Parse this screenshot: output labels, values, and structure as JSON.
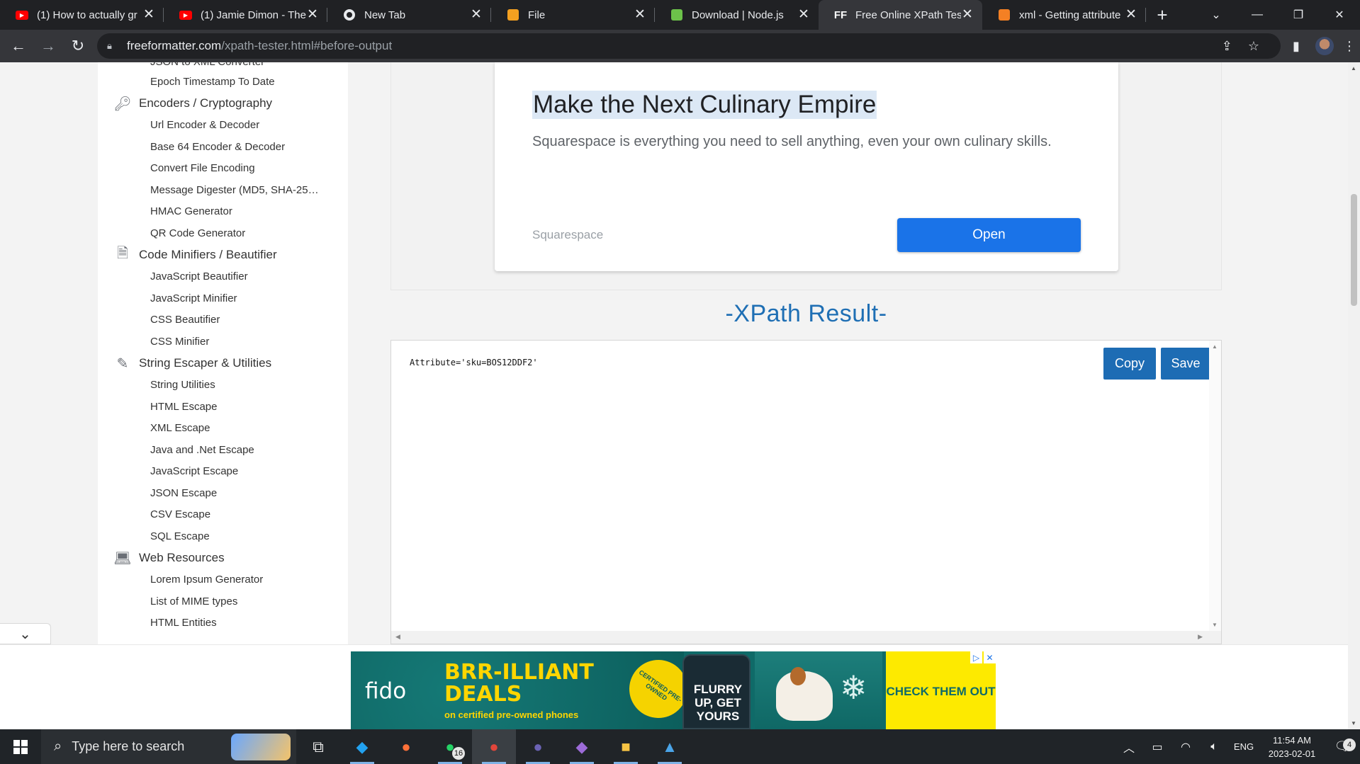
{
  "browser": {
    "tabs": [
      {
        "title": "(1) How to actually gr",
        "favicon": "youtube-icon",
        "color": "#ff0000",
        "active": false
      },
      {
        "title": "(1) Jamie Dimon - The",
        "favicon": "youtube-icon",
        "color": "#ff0000",
        "active": false
      },
      {
        "title": "New Tab",
        "favicon": "chrome-icon",
        "color": "#ffffff",
        "active": false
      },
      {
        "title": "File",
        "favicon": "notepad-icon",
        "color": "#f4a020",
        "active": false
      },
      {
        "title": "Download | Node.js",
        "favicon": "nodejs-icon",
        "color": "#6cc24a",
        "active": false
      },
      {
        "title": "Free Online XPath Tes",
        "favicon": "ff-icon",
        "color": "#ffffff",
        "active": true
      },
      {
        "title": "xml - Getting attribute",
        "favicon": "stackoverflow-icon",
        "color": "#f48024",
        "active": false
      }
    ],
    "url_host": "freeformatter.com",
    "url_path": "/xpath-tester.html#before-output"
  },
  "sidebar": {
    "cut_item": "JSON to XML Converter",
    "groups": [
      {
        "label": null,
        "icon": null,
        "items": [
          "Epoch Timestamp To Date"
        ]
      },
      {
        "label": "Encoders / Cryptography",
        "icon": "key-icon",
        "items": [
          "Url Encoder & Decoder",
          "Base 64 Encoder & Decoder",
          "Convert File Encoding",
          "Message Digester (MD5, SHA-25…",
          "HMAC Generator",
          "QR Code Generator"
        ]
      },
      {
        "label": "Code Minifiers / Beautifier",
        "icon": "file-zip-icon",
        "items": [
          "JavaScript Beautifier",
          "JavaScript Minifier",
          "CSS Beautifier",
          "CSS Minifier"
        ]
      },
      {
        "label": "String Escaper & Utilities",
        "icon": "magic-wand-icon",
        "items": [
          "String Utilities",
          "HTML Escape",
          "XML Escape",
          "Java and .Net Escape",
          "JavaScript Escape",
          "JSON Escape",
          "CSV Escape",
          "SQL Escape"
        ]
      },
      {
        "label": "Web Resources",
        "icon": "laptop-icon",
        "items": [
          "Lorem Ipsum Generator",
          "List of MIME types",
          "HTML Entities"
        ]
      }
    ]
  },
  "ad": {
    "title": "Make the Next Culinary Empire",
    "description": "Squarespace is everything you need to sell anything, even your own culinary skills.",
    "brand": "Squarespace",
    "button": "Open"
  },
  "result": {
    "title": "-XPath Result-",
    "output": "Attribute='sku=BOS12DDF2'",
    "copy_label": "Copy",
    "save_label": "Save"
  },
  "banner": {
    "logo": "fido",
    "headline_1": "BRR-ILLIANT",
    "headline_2": "DEALS",
    "sub": "on certified pre-owned phones",
    "seal": "CERTIFIED PRE-OWNED",
    "phone_text": "FLURRY UP, GET YOURS",
    "cta": "CHECK THEM OUT",
    "colors": {
      "bg": "#0f6a68",
      "accent": "#fdea00"
    }
  },
  "taskbar": {
    "search_placeholder": "Type here to search",
    "apps": [
      {
        "name": "task-view-icon",
        "glyph": "⧉"
      },
      {
        "name": "vscode-icon",
        "glyph": "◆",
        "color": "#22a2f0",
        "running": true
      },
      {
        "name": "firefox-icon",
        "glyph": "●",
        "color": "#ff7139"
      },
      {
        "name": "whatsapp-icon",
        "glyph": "●",
        "color": "#25d366",
        "running": true,
        "badge": "16"
      },
      {
        "name": "chrome-icon",
        "glyph": "●",
        "color": "#e2463b",
        "running": true,
        "active": true
      },
      {
        "name": "eclipse-icon",
        "glyph": "●",
        "color": "#6b63b5",
        "running": true
      },
      {
        "name": "visual-studio-icon",
        "glyph": "◆",
        "color": "#9c6bd8",
        "running": true
      },
      {
        "name": "file-explorer-icon",
        "glyph": "■",
        "color": "#f6c344",
        "running": true
      },
      {
        "name": "photos-icon",
        "glyph": "▲",
        "color": "#4aa4e8",
        "running": true
      }
    ],
    "language": "ENG",
    "time": "11:54 AM",
    "date": "2023-02-01",
    "notification_count": "4"
  }
}
